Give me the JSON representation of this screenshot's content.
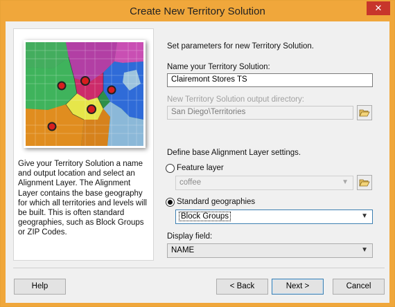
{
  "window": {
    "title": "Create New Territory Solution",
    "close_glyph": "✕"
  },
  "left": {
    "description": "Give your Territory Solution a name and output location and select an Alignment Layer. The Alignment Layer contains the base geography for which all territories and levels will be built. This is often standard geographies, such as Block Groups or ZIP Codes.",
    "map_icon": "territory-map-illustration"
  },
  "form": {
    "intro": "Set parameters for new Territory Solution.",
    "name_label": "Name your Territory Solution:",
    "name_value": "Clairemont Stores TS",
    "output_dir_label": "New Territory Solution output directory:",
    "output_dir_value": "San Diego\\Territories",
    "alignment_label": "Define base Alignment Layer settings.",
    "feature_layer_label": "Feature layer",
    "feature_layer_value": "coffee",
    "standard_geo_label": "Standard geographies",
    "standard_geo_value": "Block Groups",
    "display_field_label": "Display field:",
    "display_field_value": "NAME",
    "selected_option": "Standard geographies"
  },
  "buttons": {
    "help": "Help",
    "back": "< Back",
    "next": "Next >",
    "cancel": "Cancel"
  },
  "icons": {
    "folder": "folder-open-icon",
    "dropdown": "chevron-down-icon"
  },
  "colors": {
    "titlebar": "#f0a73b",
    "close": "#c7362b",
    "focus": "#3c7fb1"
  }
}
